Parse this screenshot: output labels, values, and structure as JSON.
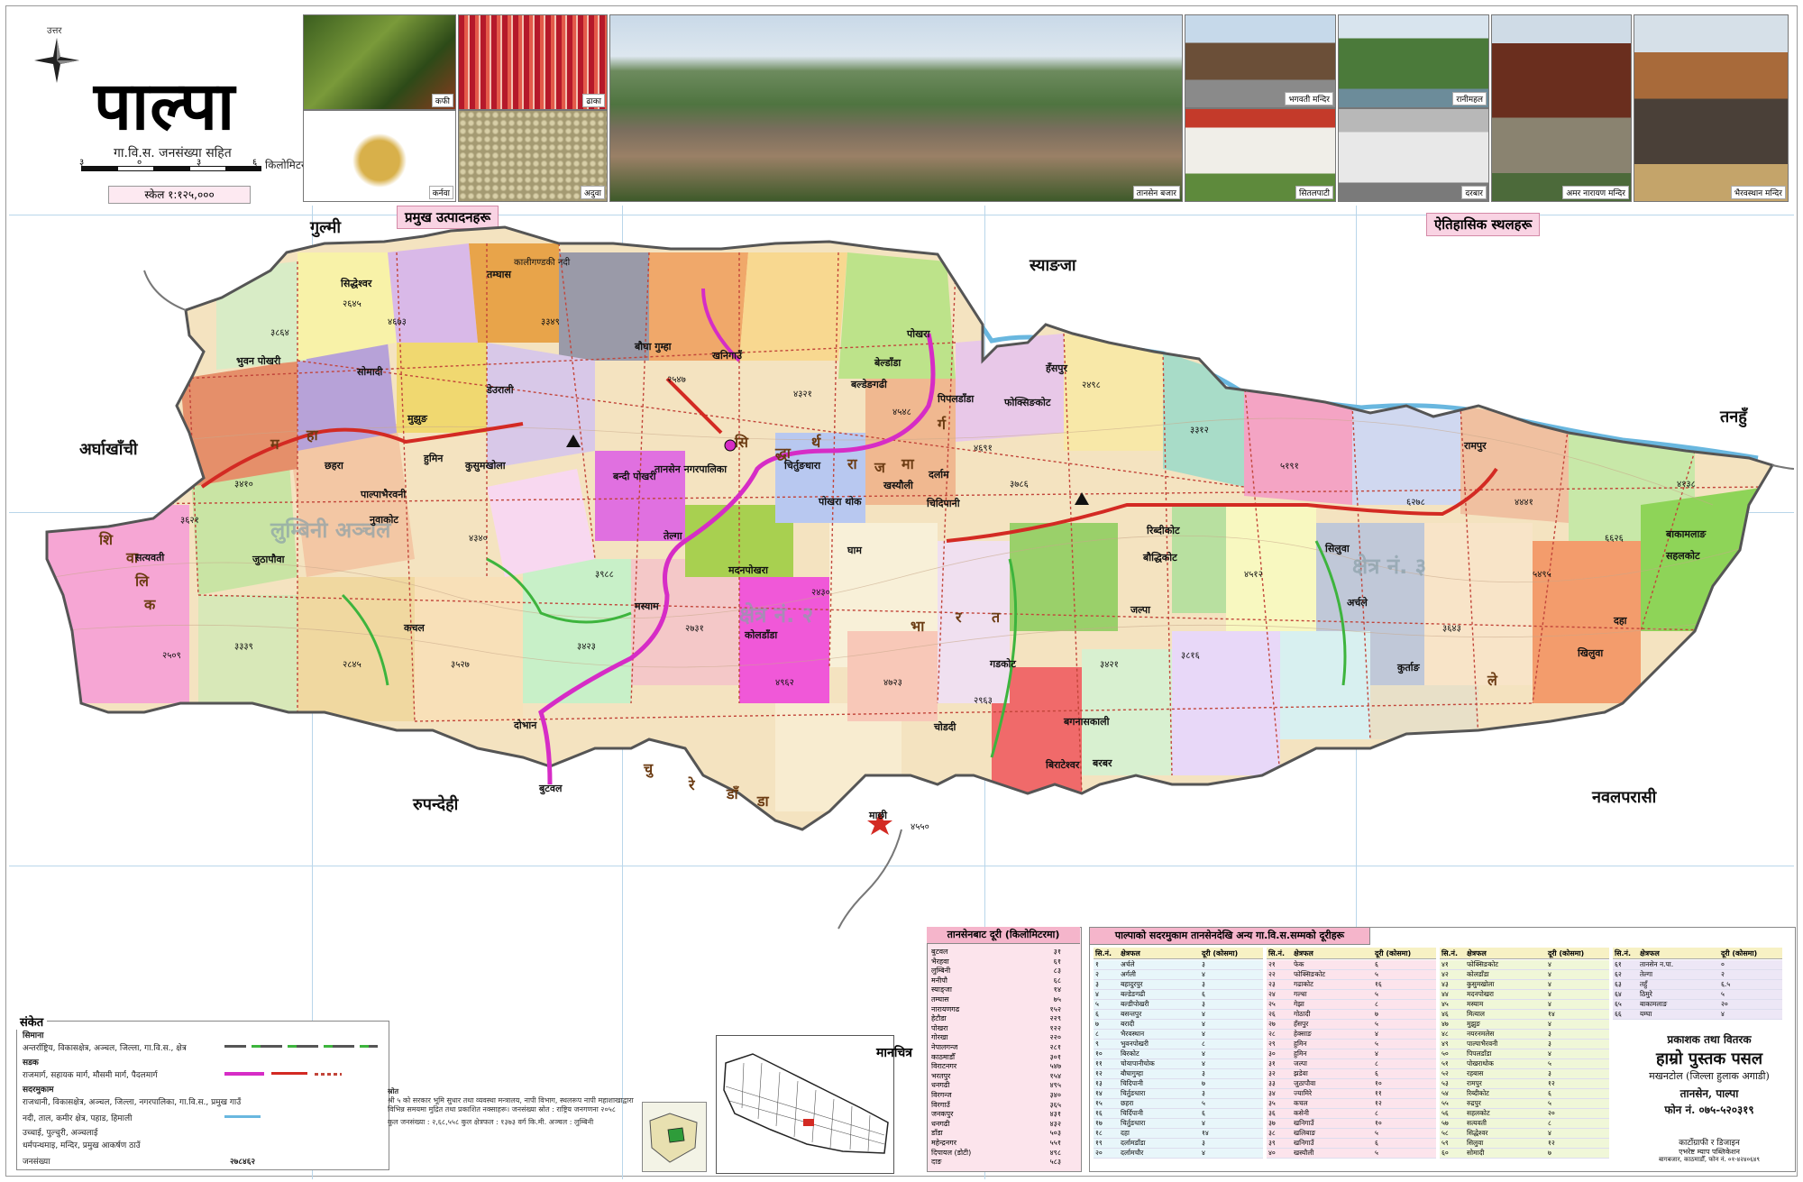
{
  "title": {
    "north_label": "उत्तर",
    "main": "पाल्पा",
    "subtitle": "गा.वि.स. जनसंख्या सहित",
    "scale_unit": "किलोमिटर",
    "scale_ticks": [
      "३",
      "०",
      "३",
      "६"
    ],
    "scale_text": "स्केल १:१२५,०००"
  },
  "photos": [
    {
      "caption": "कफी"
    },
    {
      "caption": "ढाका"
    },
    {
      "caption": "कर्नवा"
    },
    {
      "caption": "अदुवा"
    },
    {
      "caption": "तानसेन बजार"
    },
    {
      "caption": "भगवती मन्दिर"
    },
    {
      "caption": "रानीमहल"
    },
    {
      "caption": "सितलपाटी"
    },
    {
      "caption": "दरबार"
    },
    {
      "caption": "अमर नारायण मन्दिर"
    },
    {
      "caption": "भैरवस्थान मन्दिर"
    }
  ],
  "tags": {
    "products": "प्रमुख उत्पादनहरू",
    "historic": "ऐतिहासिक स्थलहरू"
  },
  "neighbors": {
    "gulmi": "गुल्मी",
    "syangja": "स्याङजा",
    "arghakhanchi": "अर्घाखाँची",
    "tanahun": "तनहुँ",
    "rupandehi": "रुपन्देही",
    "nawalparasi": "नवलपरासी"
  },
  "map_labels": {
    "pokhara": "पोखरा",
    "butwal": "बुटवल",
    "tamghas": "तम्घास",
    "kali_gandaki": "कालीगण्डकी नदी",
    "vdcs": [
      "सिद्धेश्वर",
      "भुवन पोखरी",
      "सोमादी",
      "मुझुङ",
      "छहरा",
      "पाल्पाभैरवनी",
      "हुमिन",
      "कुसुमखोला",
      "डेउराली",
      "बौघा गुम्हा",
      "खनिगाउँ",
      "बल्डेङगढी",
      "चिदिपानी",
      "तानसेन नगरपालिका",
      "बन्दी पोखरी",
      "मदनपोखरा",
      "फोक्सिङकोट",
      "रिब्दीकोट",
      "बौद्धिकोट",
      "जल्पा",
      "बगनासकाली",
      "रामपुर",
      "सिलुवा",
      "पिपलडाँडा",
      "बेल्डाँडा",
      "सत्यवती",
      "नुवाकोट",
      "कचल",
      "दोभान",
      "जुठापौवा",
      "तेल्गा",
      "पोखरा थोक",
      "घाम",
      "खस्यौली",
      "दर्लाम",
      "गडकोट",
      "चिर्तुङधारा",
      "हँसपुर",
      "बिराटेश्वर",
      "चोडदी",
      "बरबर",
      "माछी",
      "कोलडाँडा",
      "मस्याम",
      "दहा",
      "बाकामलाङ",
      "सहलकोट",
      "खिलुवा",
      "कुर्ताङ",
      "अर्चले"
    ],
    "big_road_letters": {
      "siddhartha": [
        "सि",
        "द्धा",
        "र्थ",
        "रा",
        "ज",
        "मा",
        "र्ग"
      ],
      "mahendra": [
        "म",
        "हा",
        "भा",
        "र",
        "त",
        "ले"
      ],
      "siwalik": [
        "शि",
        "वा",
        "लि",
        "क"
      ],
      "churiya": [
        "चु",
        "रे",
        "डाँ",
        "डा"
      ]
    },
    "zones": [
      "लुम्बिनी अञ्चल",
      "क्षेत्र नं. २",
      "क्षेत्र नं. ३"
    ],
    "manchitra": "मानचित्र"
  },
  "legend": {
    "title": "संकेत",
    "rows": [
      "सिमाना",
      "अन्तर्राष्ट्रिय, विकासक्षेत्र, अञ्चल, जिल्ला, गा.वि.स., क्षेत्र",
      "सडक",
      "राजमार्ग, सहायक मार्ग, मौसमी मार्ग, पैदलमार्ग",
      "सदरमुकाम",
      "राजधानी, विकासक्षेत्र, अञ्चल, जिल्ला, नगरपालिका, गा.वि.स., प्रमुख गाउँ",
      "नदी, ताल, कमीर क्षेत्र, पहाड, हिमाली",
      "उच्चाई, पुल्चुरी, अञ्चलाई",
      "धर्मपन्थमाइ, मन्दिर, प्रमुख आकर्षण ठाउँ",
      "जनसंख्या"
    ],
    "population_total": "२७८४६२"
  },
  "notes": {
    "heading": "स्रोत",
    "text": "श्री ५ को सरकार भूमि सुधार तथा व्यवस्था मन्त्रालय, नापी विभाग, स्थलरूप नापी महाशाखाद्वारा विभिन्न समयमा मुद्रित तथा प्रकाशित नक्साहरू। जनसंख्या स्रोत : राष्ट्रिय जनगणना २०५८",
    "stats": "कुल जनसंख्या : २,६८,५५८   कुल क्षेत्रफल : १३७३ वर्ग कि.मी.   अञ्चल : लुम्बिनी"
  },
  "distance_table": {
    "title": "तानसेनबाट दूरी (किलोमिटरमा)",
    "rows": [
      [
        "बुटवल",
        "३१"
      ],
      [
        "भैरहवा",
        "६१"
      ],
      [
        "लुम्बिनी",
        "८३"
      ],
      [
        "मनीपौ",
        "६८"
      ],
      [
        "स्याङ्जा",
        "१४"
      ],
      [
        "तम्घास",
        "७५"
      ],
      [
        "नारायणगढ",
        "१५२"
      ],
      [
        "हेटौडा",
        "२२९"
      ],
      [
        "पोखरा",
        "१२२"
      ],
      [
        "गोरखा",
        "२२०"
      ],
      [
        "नेपालगन्ज",
        "२८१"
      ],
      [
        "काठमाडौँ",
        "३०१"
      ],
      [
        "विराटनगर",
        "५४७"
      ],
      [
        "भरतपुर",
        "१५४"
      ],
      [
        "धनगढी",
        "४९५"
      ],
      [
        "विरगन्ज",
        "३४०"
      ],
      [
        "विरगाउँ",
        "३६५"
      ],
      [
        "जनकपुर",
        "४३१"
      ],
      [
        "धनगढी",
        "४३२"
      ],
      [
        "डाँडा",
        "५०३"
      ],
      [
        "महेन्द्रनगर",
        "५५१"
      ],
      [
        "दिपायल (डोटी)",
        "४९८"
      ],
      [
        "दाङ",
        "५८३"
      ]
    ]
  },
  "vdc_table": {
    "title": "पाल्पाको सदरमुकाम तानसेनदेखि अन्य गा.वि.स.सम्मको दूरीहरू",
    "headers": [
      "सि.नं.",
      "क्षेत्रफल",
      "दूरी (कोसमा)"
    ],
    "columns": [
      [
        [
          "१",
          "अर्चले",
          "३"
        ],
        [
          "२",
          "अर्गली",
          "४"
        ],
        [
          "३",
          "बहादुरपुर",
          "३"
        ],
        [
          "४",
          "बल्डेङगढी",
          "६"
        ],
        [
          "५",
          "बल्डीपोखरी",
          "३"
        ],
        [
          "६",
          "बसन्तपुर",
          "४"
        ],
        [
          "७",
          "बरादी",
          "४"
        ],
        [
          "८",
          "भैरवस्थान",
          "४"
        ],
        [
          "९",
          "भुवनपोखरी",
          "८"
        ],
        [
          "१०",
          "बिरकोट",
          "४"
        ],
        [
          "११",
          "चोयापानीचोक",
          "४"
        ],
        [
          "१२",
          "बौघागुम्हा",
          "३"
        ],
        [
          "१३",
          "चिदिपानी",
          "७"
        ],
        [
          "१४",
          "चिर्तुङधारा",
          "३"
        ],
        [
          "१५",
          "छहरा",
          "५"
        ],
        [
          "१६",
          "चिर्दिपानी",
          "६"
        ],
        [
          "१७",
          "चिर्तुङधारा",
          "४"
        ],
        [
          "१८",
          "दहा",
          "१४"
        ],
        [
          "१९",
          "दर्लामडाँडा",
          "३"
        ],
        [
          "२०",
          "दर्लामचौर",
          "४"
        ]
      ],
      [
        [
          "२१",
          "फेक",
          "६"
        ],
        [
          "२२",
          "फोक्सिङकोट",
          "५"
        ],
        [
          "२३",
          "गढाकोट",
          "१६"
        ],
        [
          "२४",
          "गल्धा",
          "५"
        ],
        [
          "२५",
          "गेझा",
          "८"
        ],
        [
          "२६",
          "गोठादी",
          "७"
        ],
        [
          "२७",
          "हँसपुर",
          "५"
        ],
        [
          "२८",
          "हेक्साङ",
          "४"
        ],
        [
          "२९",
          "हुमिन",
          "५"
        ],
        [
          "३०",
          "हुमिन",
          "४"
        ],
        [
          "३१",
          "जल्पा",
          "८"
        ],
        [
          "३२",
          "झडेवा",
          "६"
        ],
        [
          "३३",
          "जुठापौवा",
          "१०"
        ],
        [
          "३४",
          "ज्यामिरे",
          "११"
        ],
        [
          "३५",
          "कचल",
          "१२"
        ],
        [
          "३६",
          "कसेनी",
          "८"
        ],
        [
          "३७",
          "खनिगाउँ",
          "१०"
        ],
        [
          "३८",
          "खलिबाङ",
          "५"
        ],
        [
          "३९",
          "खनिगाउँ",
          "६"
        ],
        [
          "४०",
          "खस्यौली",
          "५"
        ]
      ],
      [
        [
          "४१",
          "फोक्सिङकोट",
          "४"
        ],
        [
          "४२",
          "कोलडाँडा",
          "४"
        ],
        [
          "४३",
          "कुसुमखोला",
          "४"
        ],
        [
          "४४",
          "मदनपोखरा",
          "४"
        ],
        [
          "४५",
          "मस्याम",
          "४"
        ],
        [
          "४६",
          "मित्याल",
          "१४"
        ],
        [
          "४७",
          "मुझुङ",
          "४"
        ],
        [
          "४८",
          "नयरनमलेस",
          "३"
        ],
        [
          "४९",
          "पाल्पाभैरवनी",
          "३"
        ],
        [
          "५०",
          "पिपलडाँडा",
          "४"
        ],
        [
          "५१",
          "पोखराथोक",
          "५"
        ],
        [
          "५२",
          "रहबास",
          "३"
        ],
        [
          "५३",
          "रामपुर",
          "१२"
        ],
        [
          "५४",
          "रिब्दीकोट",
          "६"
        ],
        [
          "५५",
          "रुद्रपुर",
          "५"
        ],
        [
          "५६",
          "सहलकोट",
          "२०"
        ],
        [
          "५७",
          "सत्यवती",
          "८"
        ],
        [
          "५८",
          "सिद्धेश्वर",
          "४"
        ],
        [
          "५९",
          "सिलुवा",
          "१२"
        ],
        [
          "६०",
          "सोमादी",
          "७"
        ]
      ],
      [
        [
          "६१",
          "तानसेन न.पा.",
          "०"
        ],
        [
          "६२",
          "तेल्गा",
          "२"
        ],
        [
          "६३",
          "तहुँ",
          "६.५"
        ],
        [
          "६४",
          "ठिमुरे",
          "५"
        ],
        [
          "६५",
          "बाकामलाङ",
          "२०"
        ],
        [
          "६६",
          "यम्घा",
          "४"
        ]
      ]
    ]
  },
  "publisher": {
    "line1": "प्रकाशक तथा वितरक",
    "line2": "हाम्रो पुस्तक पसल",
    "line3": "मखनटोल (जिल्ला हुलाक अगाडी)",
    "line4": "तानसेन, पाल्पा",
    "line5": "फोन नं. ०७५-५२०३१९",
    "line6": "कार्टोग्राफी र डिजाइन",
    "line7": "एभरेष्ट म्याप पब्लिकेशन",
    "line8": "बागबजार, काठमाडौँ, फोन नं. ०१-४२४०६४९"
  }
}
